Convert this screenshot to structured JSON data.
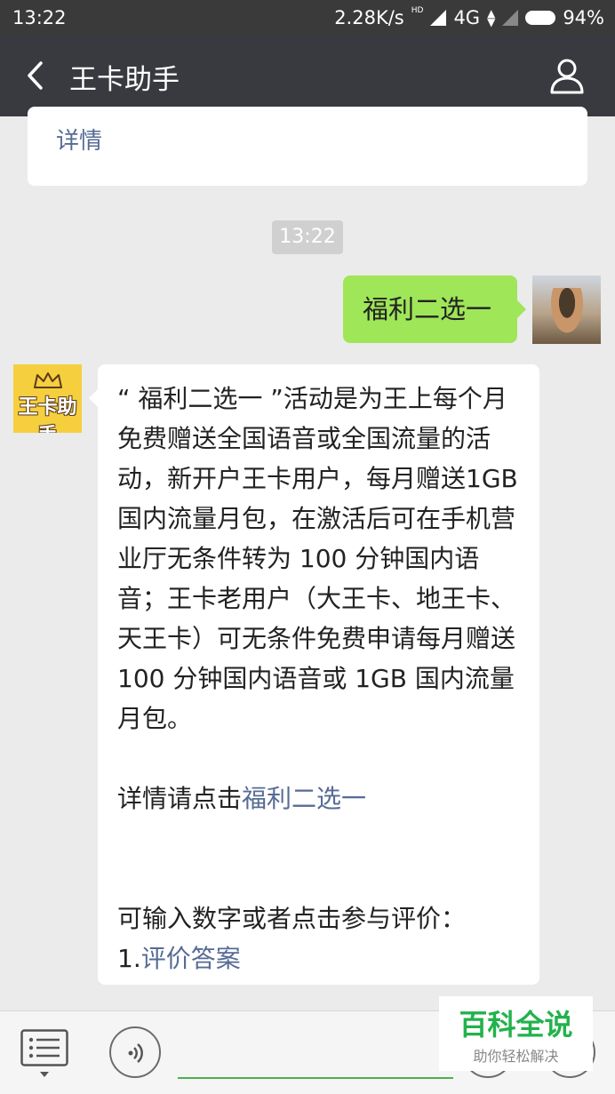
{
  "status_bar": {
    "time": "13:22",
    "network_speed": "2.28K/s",
    "hd_badge": "HD",
    "network_type": "4G",
    "battery": "94%"
  },
  "nav": {
    "title": "王卡助手"
  },
  "prev_card": {
    "link": "详情"
  },
  "chat": {
    "timestamp": "13:22",
    "user_message": "福利二选一",
    "bot_message": {
      "paragraph": "“ 福利二选一 ”活动是为王上每个月免费赠送全国语音或全国流量的活动，新开户王卡用户，每月赠送1GB 国内流量月包，在激活后可在手机营业厅无条件转为 100 分钟国内语音；王卡老用户（大王卡、地王卡、天王卡）可无条件免费申请每月赠送 100 分钟国内语音或 1GB 国内流量月包。",
      "detail_prefix": "详情请点击",
      "detail_link": "福利二选一",
      "rate_prompt": "可输入数字或者点击参与评价：",
      "rate_number": "1.",
      "rate_link": "评价答案"
    },
    "bot_avatar_text": "王卡助手"
  },
  "watermark": {
    "title": "百科全说",
    "subtitle": "助你轻松解决"
  },
  "colors": {
    "nav_bg": "#393a3f",
    "status_bg": "#3a3a3a",
    "chat_bg": "#ebebeb",
    "user_bubble": "#9fe658",
    "link": "#576b95",
    "watermark_green": "#22b24c"
  }
}
